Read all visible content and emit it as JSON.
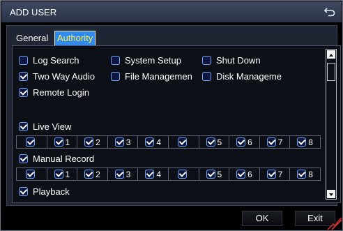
{
  "window": {
    "title": "ADD USER"
  },
  "tabs": [
    {
      "label": "General"
    },
    {
      "label": "Authority"
    }
  ],
  "permissions": {
    "log_search": {
      "label": "Log Search",
      "checked": false
    },
    "system_setup": {
      "label": "System Setup",
      "checked": false
    },
    "shut_down": {
      "label": "Shut Down",
      "checked": false
    },
    "two_way_audio": {
      "label": "Two Way Audio",
      "checked": true
    },
    "file_management": {
      "label": "File Managemen",
      "checked": false
    },
    "disk_management": {
      "label": "Disk Manageme",
      "checked": false
    },
    "remote_login": {
      "label": "Remote Login",
      "checked": true
    },
    "live_view": {
      "label": "Live View",
      "checked": true
    },
    "manual_record": {
      "label": "Manual Record",
      "checked": true
    },
    "playback": {
      "label": "Playback",
      "checked": true
    }
  },
  "channels": [
    "",
    "1",
    "2",
    "3",
    "4",
    "",
    "5",
    "6",
    "7",
    "8"
  ],
  "buttons": {
    "ok": "OK",
    "exit": "Exit"
  },
  "colors": {
    "selected_tab": "#2f8bf0",
    "selected_tab_text": "#ffec3f",
    "checkbox_border": "#6ea7f1"
  }
}
